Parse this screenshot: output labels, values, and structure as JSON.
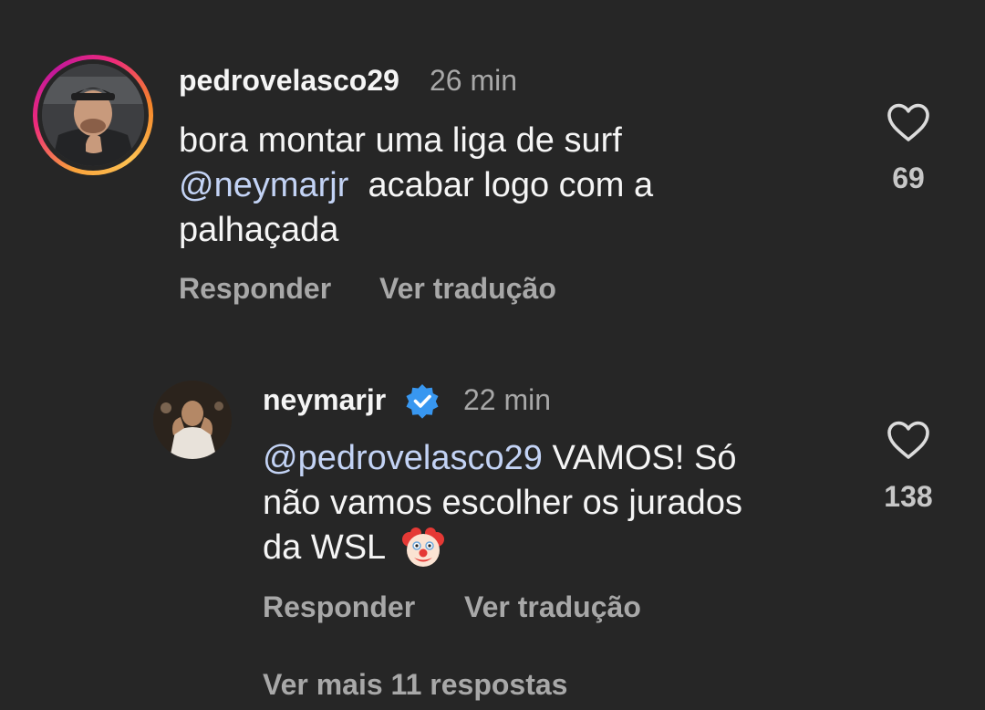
{
  "comments": [
    {
      "username": "pedrovelasco29",
      "time": "26 min",
      "lines": [
        {
          "mention": "",
          "text": "bora montar uma liga de surf"
        },
        {
          "mention": "@neymarjr",
          "text": "  acabar logo com a"
        },
        {
          "mention": "",
          "text": "palhaçada"
        }
      ],
      "likes": "69",
      "reply_label": "Responder",
      "translate_label": "Ver tradução",
      "has_story_ring": true
    },
    {
      "username": "neymarjr",
      "verified": true,
      "time": "22 min",
      "lines": [
        {
          "mention": "@pedrovelasco29",
          "text": " VAMOS! Só"
        },
        {
          "mention": "",
          "text": "não vamos escolher os jurados"
        },
        {
          "mention": "",
          "text": "da WSL "
        }
      ],
      "emoji": "clown-face",
      "likes": "138",
      "reply_label": "Responder",
      "translate_label": "Ver tradução"
    }
  ],
  "view_more_replies": "Ver mais 11 respostas",
  "colors": {
    "background": "#262626",
    "primary_text": "#f5f5f5",
    "secondary_text": "#a8a8a8",
    "mention": "#c3d3f5",
    "verified_badge": "#3897f0"
  },
  "icons": {
    "like": "heart-outline-icon",
    "verified": "verified-badge-icon"
  }
}
